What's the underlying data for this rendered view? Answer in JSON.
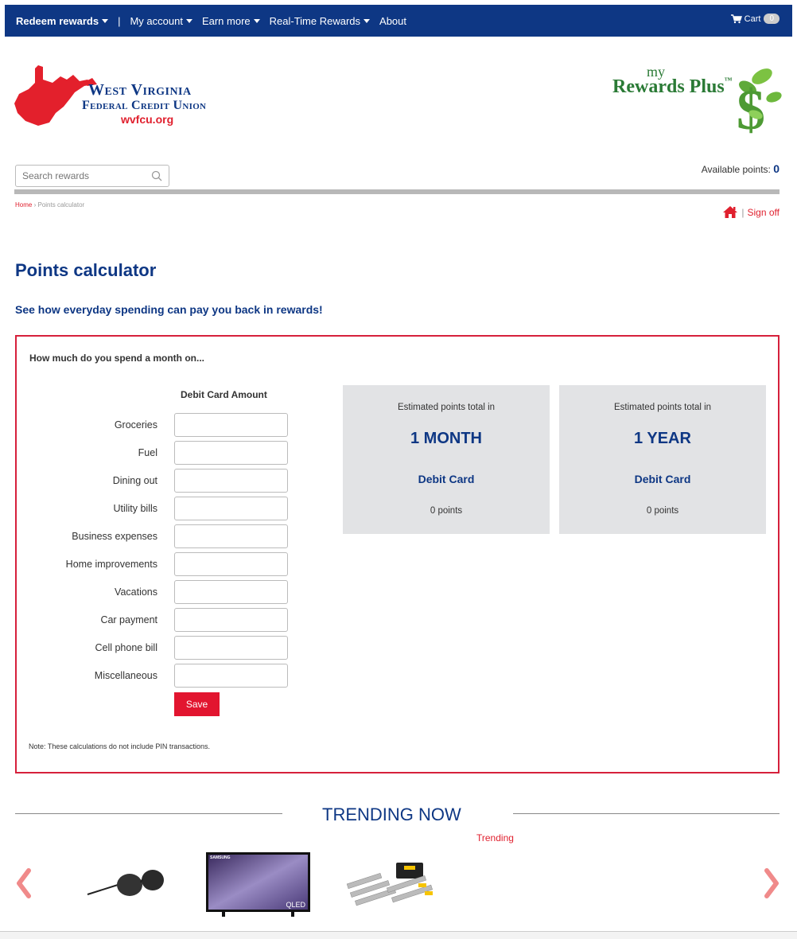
{
  "nav": {
    "items": [
      {
        "label": "Redeem rewards",
        "bold": true,
        "caret": true
      },
      {
        "label": "My account",
        "bold": false,
        "caret": true
      },
      {
        "label": "Earn more",
        "bold": false,
        "caret": true
      },
      {
        "label": "Real-Time Rewards",
        "bold": false,
        "caret": true
      },
      {
        "label": "About",
        "bold": false,
        "caret": false
      }
    ],
    "separator": "|",
    "cart_label": "Cart",
    "cart_count": "0"
  },
  "logo": {
    "line1": "West Virginia",
    "line2": "Federal Credit Union",
    "site": "wvfcu.org",
    "program_my": "my",
    "program_name": "Rewards Plus",
    "program_tm": "™"
  },
  "search": {
    "placeholder": "Search rewards",
    "icon": "search-icon"
  },
  "points": {
    "label": "Available points:",
    "value": "0"
  },
  "breadcrumb": {
    "home": "Home",
    "sep": "›",
    "current": "Points calculator"
  },
  "account": {
    "home_icon": "home-icon",
    "sign_off": "Sign off",
    "pipe": "|"
  },
  "page": {
    "title": "Points calculator",
    "subtitle": "See how everyday spending can pay you back in rewards!"
  },
  "calculator": {
    "question": "How much do you spend a month on...",
    "column_header": "Debit Card Amount",
    "rows": [
      {
        "label": "Groceries",
        "value": ""
      },
      {
        "label": "Fuel",
        "value": ""
      },
      {
        "label": "Dining out",
        "value": ""
      },
      {
        "label": "Utility bills",
        "value": ""
      },
      {
        "label": "Business expenses",
        "value": ""
      },
      {
        "label": "Home improvements",
        "value": ""
      },
      {
        "label": "Vacations",
        "value": ""
      },
      {
        "label": "Car payment",
        "value": ""
      },
      {
        "label": "Cell phone bill",
        "value": ""
      },
      {
        "label": "Miscellaneous",
        "value": ""
      }
    ],
    "save_label": "Save",
    "note": "Note: These calculations do not include PIN transactions.",
    "estimates": [
      {
        "label": "Estimated points total in",
        "period": "1 MONTH",
        "card": "Debit Card",
        "points": "0 points"
      },
      {
        "label": "Estimated points total in",
        "period": "1 YEAR",
        "card": "Debit Card",
        "points": "0 points"
      }
    ]
  },
  "trending": {
    "title": "TRENDING NOW",
    "subtitle": "Trending",
    "products": [
      {
        "name": "sunglasses"
      },
      {
        "name": "tv",
        "brand": "SAMSUNG",
        "badge": "QLED"
      },
      {
        "name": "tool-set"
      }
    ]
  },
  "colors": {
    "navy": "#0e3784",
    "red": "#e0202e",
    "box_border": "#d6203b",
    "green": "#2a7a35"
  }
}
